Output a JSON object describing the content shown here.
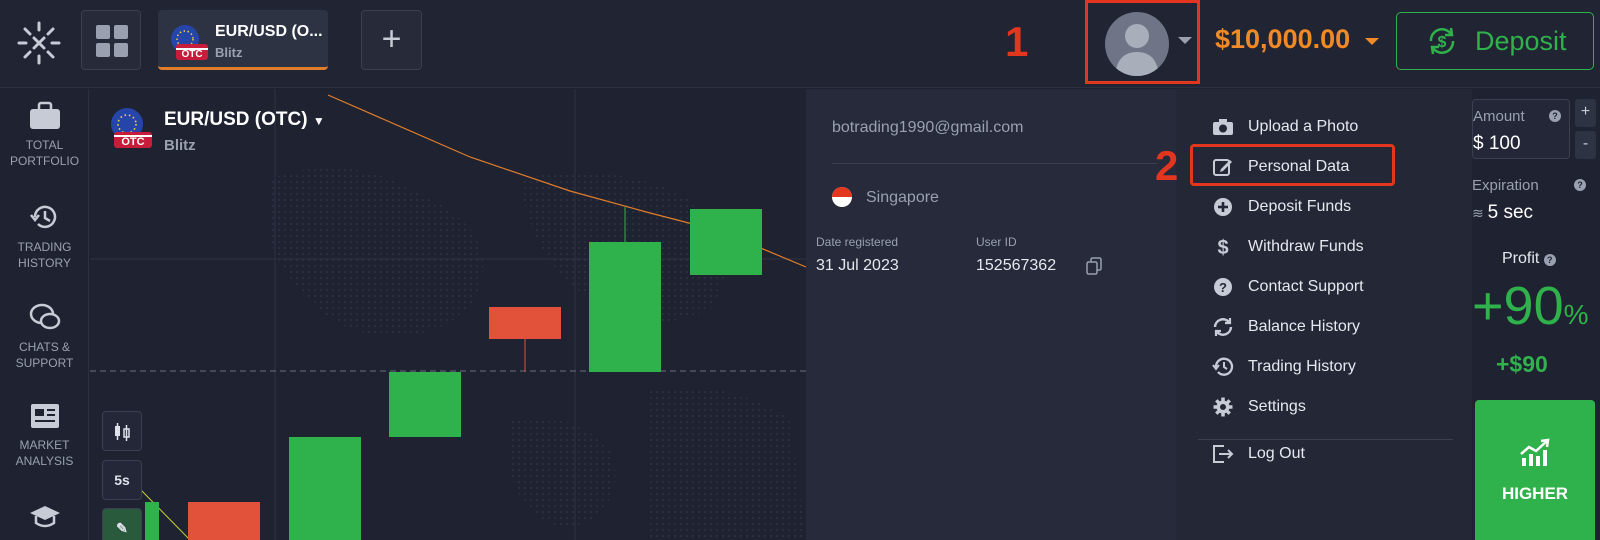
{
  "topbar": {
    "asset_tab": {
      "name": "EUR/USD (O...",
      "badge": "OTC",
      "sub": "Blitz"
    },
    "plus_label": "+",
    "step1": "1",
    "balance": "$10,000.00",
    "deposit_label": "Deposit"
  },
  "sidebar": {
    "items": [
      {
        "label": "TOTAL PORTFOLIO",
        "icon": "briefcase-icon"
      },
      {
        "label": "TRADING HISTORY",
        "icon": "history-icon"
      },
      {
        "label": "CHATS & SUPPORT",
        "icon": "chat-icon"
      },
      {
        "label": "MARKET ANALYSIS",
        "icon": "news-icon"
      }
    ]
  },
  "chart": {
    "asset_name": "EUR/USD (OTC)",
    "asset_badge": "OTC",
    "asset_sub": "Blitz",
    "timeframe": "5s"
  },
  "profile": {
    "email": "botrading1990@gmail.com",
    "country": "Singapore",
    "date_label": "Date registered",
    "date_value": "31 Jul 2023",
    "userid_label": "User ID",
    "userid_value": "152567362"
  },
  "menu": {
    "step2": "2",
    "items": [
      {
        "label": "Upload a Photo",
        "icon": "camera-icon"
      },
      {
        "label": "Personal Data",
        "icon": "edit-icon"
      },
      {
        "label": "Deposit Funds",
        "icon": "plus-circle-icon"
      },
      {
        "label": "Withdraw Funds",
        "icon": "dollar-icon"
      },
      {
        "label": "Contact Support",
        "icon": "help-icon"
      },
      {
        "label": "Balance History",
        "icon": "refresh-icon"
      },
      {
        "label": "Trading History",
        "icon": "history-icon"
      },
      {
        "label": "Settings",
        "icon": "gear-icon"
      },
      {
        "label": "Log Out",
        "icon": "logout-icon"
      }
    ]
  },
  "trade": {
    "amount_label": "Amount",
    "amount_value": "$ 100",
    "plus": "+",
    "minus": "-",
    "expiration_label": "Expiration",
    "expiration_value": "5 sec",
    "profit_label": "Profit",
    "profit_pct": "+90",
    "profit_pct_unit": "%",
    "profit_abs": "+$90",
    "higher_label": "HIGHER"
  },
  "colors": {
    "accent_orange": "#f08a26",
    "green": "#2fb14b",
    "red": "#e3361f",
    "bg": "#1d2130"
  }
}
